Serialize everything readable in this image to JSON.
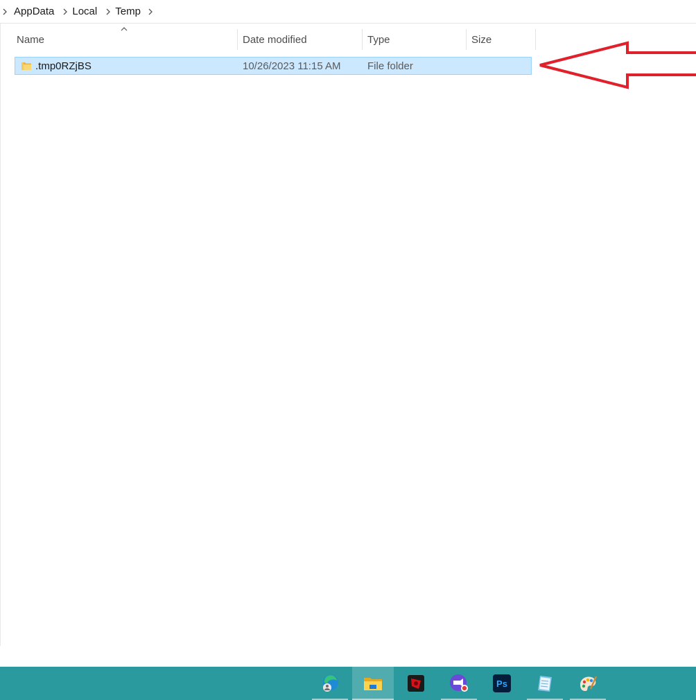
{
  "breadcrumb": {
    "items": [
      {
        "label": "AppData"
      },
      {
        "label": "Local"
      },
      {
        "label": "Temp"
      }
    ]
  },
  "columns": {
    "name": "Name",
    "date_modified": "Date modified",
    "type": "Type",
    "size": "Size"
  },
  "files": [
    {
      "name": ".tmp0RZjBS",
      "date_modified": "10/26/2023 11:15 AM",
      "type": "File folder",
      "size": "",
      "selected": true,
      "icon": "folder-icon"
    }
  ],
  "colors": {
    "selection_bg": "#cce8ff",
    "selection_border": "#99d1ff",
    "arrow": "#e0202a",
    "taskbar": "#2a9a9e"
  },
  "taskbar": {
    "apps": [
      {
        "icon": "edge-profile-icon",
        "active": false,
        "running": true
      },
      {
        "icon": "file-explorer-icon",
        "active": true,
        "running": true
      },
      {
        "icon": "red-app-icon",
        "active": false,
        "running": false
      },
      {
        "icon": "screen-recorder-icon",
        "active": false,
        "running": true
      },
      {
        "icon": "photoshop-icon",
        "active": false,
        "running": false
      },
      {
        "icon": "notepad-icon",
        "active": false,
        "running": true
      },
      {
        "icon": "paint-icon",
        "active": false,
        "running": true
      }
    ]
  }
}
